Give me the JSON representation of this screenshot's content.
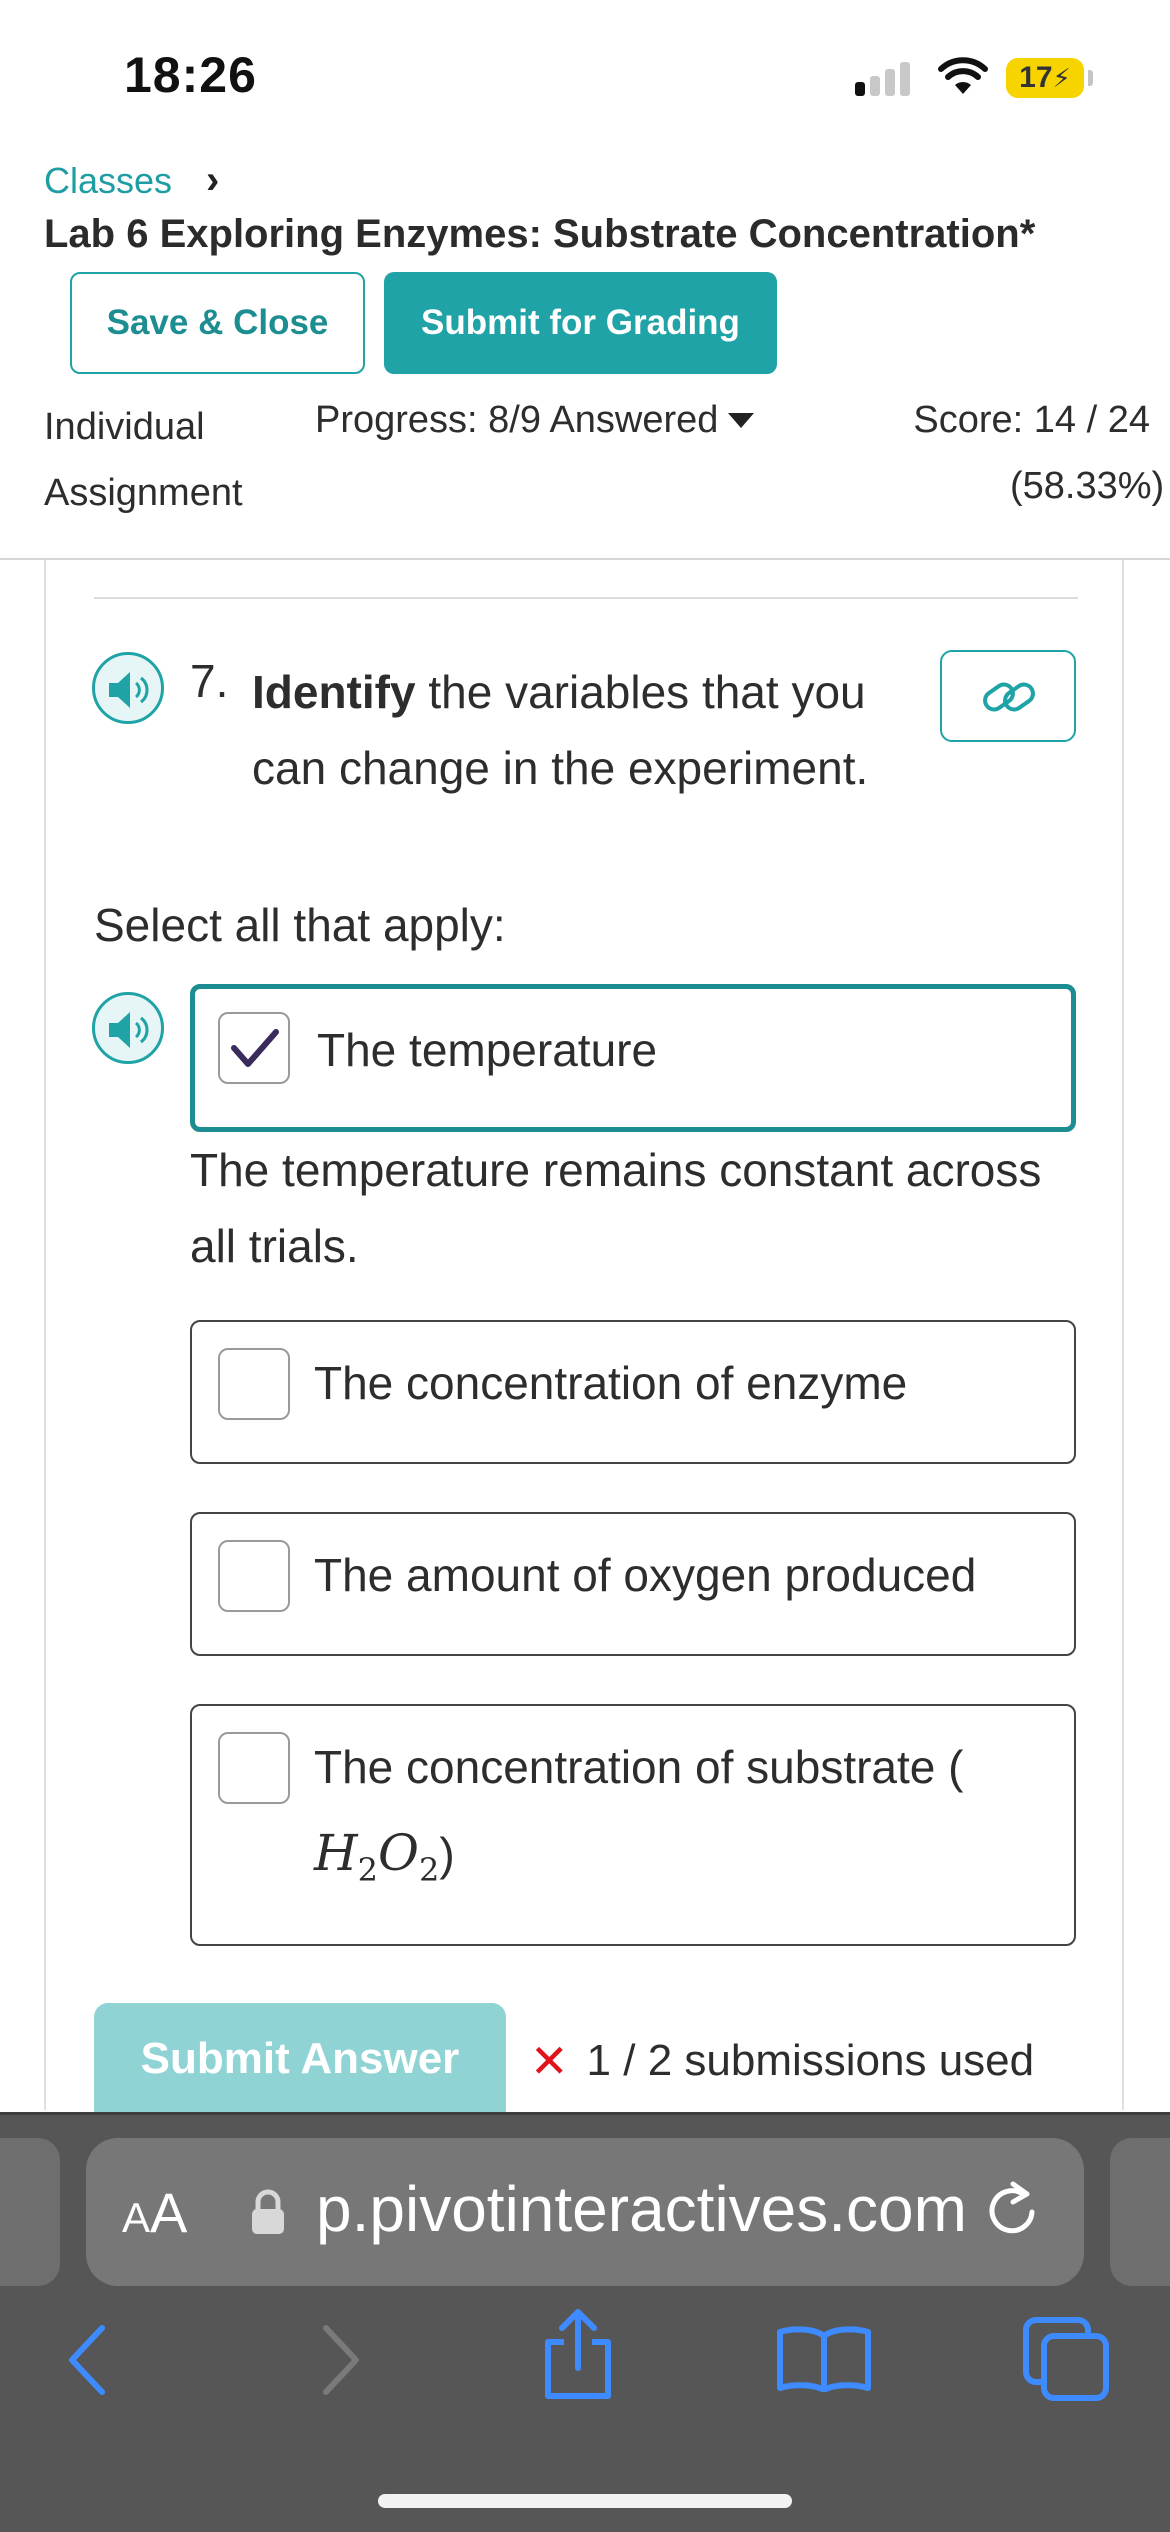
{
  "status_bar": {
    "time": "18:26",
    "battery": "17"
  },
  "header": {
    "breadcrumb": "Classes",
    "title": "Lab 6 Exploring Enzymes: Substrate Concentration*",
    "save_close_label": "Save & Close",
    "submit_grading_label": "Submit for Grading",
    "assignment_type_line1": "Individual",
    "assignment_type_line2": "Assignment",
    "progress": "Progress: 8/9 Answered",
    "score": "Score: 14 / 24",
    "score_percent": "(58.33%)"
  },
  "question": {
    "number": "7.",
    "bold_word": "Identify",
    "text": " the variables that you can change in the experiment.",
    "instruction": "Select all that apply:",
    "options": [
      {
        "label": "The temperature",
        "checked": true
      },
      {
        "label": "The concentration of enzyme",
        "checked": false
      },
      {
        "label": "The amount of oxygen produced",
        "checked": false
      },
      {
        "label": "The concentration of substrate (",
        "formula": "H2O2",
        "formula_close": ")",
        "checked": false
      }
    ],
    "feedback": "The temperature remains constant across all trials.",
    "submit_label": "Submit Answer",
    "submissions_icon": "x-mark",
    "submissions_text": "1 / 2 submissions used"
  },
  "browser": {
    "aa_label": "AA",
    "url": "p.pivotinteractives.com"
  },
  "colors": {
    "accent": "#1fa3a6",
    "accent_light": "#8fd3d5",
    "error": "#e0141a",
    "chrome": "#565656"
  }
}
